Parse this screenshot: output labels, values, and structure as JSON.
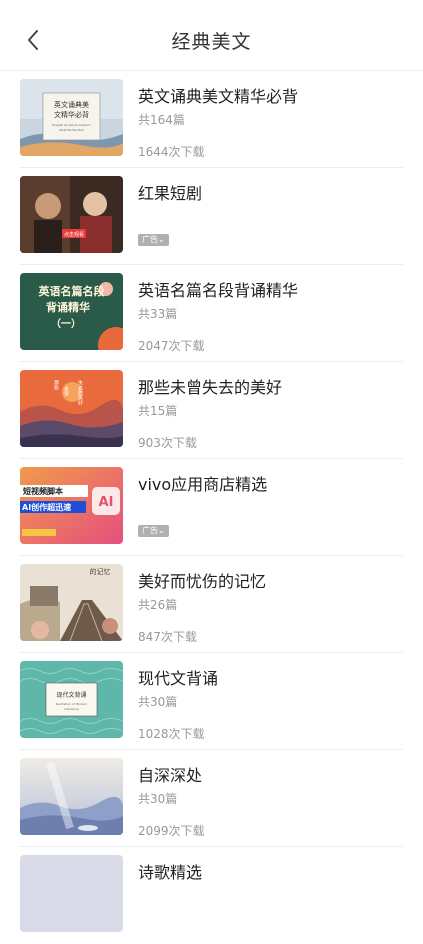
{
  "header": {
    "title": "经典美文"
  },
  "items": [
    {
      "name": "英文诵典美文精华必背",
      "count": "共164篇",
      "downloads": "1644次下载",
      "cover_text": [
        "英文诵典美",
        "文精华必背"
      ],
      "cover_subtext": [
        "English Scripture Classics",
        "Must Be Recited"
      ]
    },
    {
      "name": "红果短剧",
      "ad": "广告",
      "cover_text": [
        "点击观看"
      ]
    },
    {
      "name": "英语名篇名段背诵精华",
      "count": "共33篇",
      "downloads": "2047次下载",
      "cover_text": [
        "英语名篇名段",
        "背诵精华",
        "（一）"
      ]
    },
    {
      "name": "那些未曾失去的美好",
      "count": "共15篇",
      "downloads": "903次下载",
      "cover_text": [
        "失去的美好",
        "那些",
        "未曾"
      ]
    },
    {
      "name": "vivo应用商店精选",
      "ad": "广告",
      "cover_text": [
        "短视频脚本",
        "AI创作超迅速",
        "AI"
      ]
    },
    {
      "name": "美好而忧伤的记忆",
      "count": "共26篇",
      "downloads": "847次下载",
      "cover_text": [
        "的记忆"
      ]
    },
    {
      "name": "现代文背诵",
      "count": "共30篇",
      "downloads": "1028次下载",
      "cover_text": [
        "现代文背诵"
      ],
      "cover_subtext": [
        "Recitation of Modern",
        "Literature"
      ]
    },
    {
      "name": "自深深处",
      "count": "共30篇",
      "downloads": "2099次下载"
    },
    {
      "name": "诗歌精选"
    }
  ]
}
